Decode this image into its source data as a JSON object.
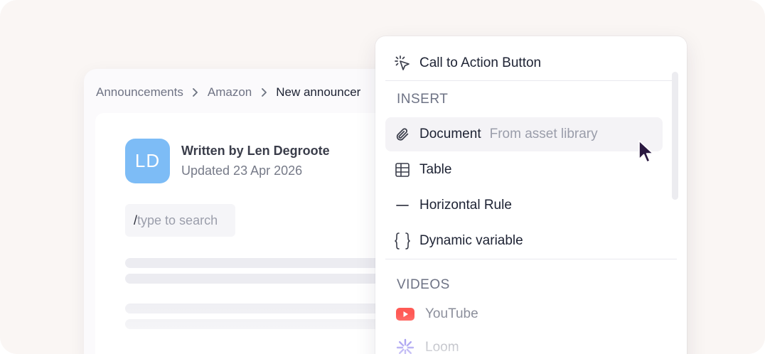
{
  "breadcrumb": {
    "items": [
      "Announcements",
      "Amazon",
      "New announcer"
    ]
  },
  "author": {
    "initials": "LD",
    "name": "Written by Len Degroote",
    "updated": "Updated 23 Apr 2026",
    "avatar_color": "#7dbcf6"
  },
  "editor": {
    "slash": "/",
    "placeholder": "type to search"
  },
  "menu": {
    "top_item": {
      "label": "Call to Action Button",
      "icon": "pointer-click-icon"
    },
    "insert": {
      "heading": "INSERT",
      "items": [
        {
          "label": "Document",
          "hint": "From asset library",
          "icon": "paperclip-icon"
        },
        {
          "label": "Table",
          "icon": "table-icon"
        },
        {
          "label": "Horizontal Rule",
          "icon": "horizontal-rule-icon"
        },
        {
          "label": "Dynamic variable",
          "icon": "curly-braces-icon"
        }
      ]
    },
    "videos": {
      "heading": "VIDEOS",
      "items": [
        {
          "label": "YouTube",
          "icon": "youtube-icon",
          "color": "#ff4b4b"
        },
        {
          "label": "Loom",
          "icon": "loom-icon",
          "color": "#6c5ce7"
        }
      ]
    }
  }
}
